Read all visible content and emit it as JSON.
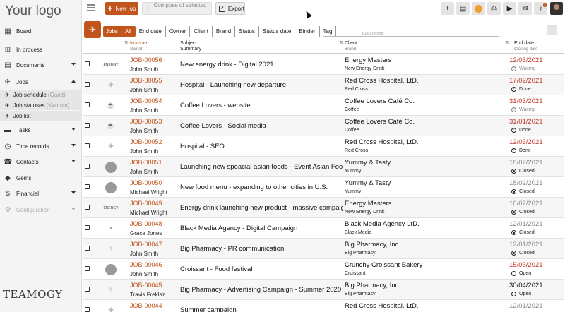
{
  "app": {
    "logo_text": "Your logo",
    "brand_logo_text": "TEAMOGY"
  },
  "toolbar": {
    "new_job_label": "New job",
    "compose_label": "Compose of selected ...",
    "export_label": "Export",
    "notification_count": "1",
    "icons": [
      "plus-icon",
      "notes-icon",
      "help-icon",
      "print-icon",
      "video-icon",
      "chat-icon",
      "bell-icon",
      "avatar"
    ]
  },
  "sidebar": {
    "items": [
      {
        "label": "Board",
        "icon": "grid-icon"
      },
      {
        "label": "In process",
        "icon": "process-icon"
      },
      {
        "label": "Documents",
        "icon": "document-icon"
      },
      {
        "label": "Jobs",
        "icon": "rocket-icon"
      },
      {
        "label": "Tasks",
        "icon": "tasks-icon"
      },
      {
        "label": "Time records",
        "icon": "clock-icon"
      },
      {
        "label": "Contacts",
        "icon": "contacts-icon"
      },
      {
        "label": "Gems",
        "icon": "gem-icon"
      },
      {
        "label": "Financial",
        "icon": "dollar-icon"
      },
      {
        "label": "Configuration",
        "icon": "gear-icon"
      }
    ],
    "jobs_sub": [
      {
        "label": "Job schedule",
        "muted": "(Gantt)"
      },
      {
        "label": "Job statuses",
        "muted": "(Kanban)"
      },
      {
        "label": "Job list",
        "muted": ""
      }
    ]
  },
  "filters": {
    "section": "Jobs",
    "active": "All",
    "crumbs": [
      "End date",
      "Owner",
      "Client",
      "Brand",
      "Status",
      "Status date",
      "Binder",
      "Tag"
    ],
    "search_count": "61/61 records"
  },
  "table": {
    "headers": {
      "number": "Number",
      "owner": "Owner",
      "subject": "Subject",
      "summary": "Summary",
      "client": "Client",
      "brand": "Brand",
      "end_date": "End date",
      "closing_date": "Closing date"
    },
    "rows": [
      {
        "thumb": "ENERGY",
        "thumb_style": "text",
        "number": "JOB-00056",
        "owner": "John Smith",
        "summary": "New energy drink - Digital 2021",
        "client": "Energy Masters",
        "brand": "New Energy Drink",
        "date": "12/03/2021",
        "date_color": "red",
        "status": "Waiting",
        "status_style": "muted"
      },
      {
        "thumb": "✚",
        "thumb_style": "faint",
        "number": "JOB-00055",
        "owner": "John Smith",
        "summary": "Hospital - Launching new departure",
        "client": "Red Cross Hospital, LtD.",
        "brand": "Red Cross",
        "date": "17/02/2021",
        "date_color": "red",
        "status": "Done",
        "status_style": "done"
      },
      {
        "thumb": "☕",
        "thumb_style": "faint",
        "number": "JOB-00054",
        "owner": "John Smith",
        "summary": "Coffee Lovers - website",
        "client": "Coffee Lovers Café Co.",
        "brand": "Coffee",
        "date": "31/03/2021",
        "date_color": "red",
        "status": "Waiting",
        "status_style": "muted"
      },
      {
        "thumb": "☕",
        "thumb_style": "faint",
        "number": "JOB-00053",
        "owner": "John Smith",
        "summary": "Coffee Lovers - Social media",
        "client": "Coffee Lovers Café Co.",
        "brand": "Coffee",
        "date": "31/01/2021",
        "date_color": "red",
        "status": "Done",
        "status_style": "done"
      },
      {
        "thumb": "✚",
        "thumb_style": "faint",
        "number": "JOB-00052",
        "owner": "John Smith",
        "summary": "Hospital - SEO",
        "client": "Red Cross Hospital, LtD.",
        "brand": "Red Cross",
        "date": "12/03/2021",
        "date_color": "red",
        "status": "Done",
        "status_style": "done"
      },
      {
        "thumb": "",
        "thumb_style": "circle",
        "number": "JOB-00051",
        "owner": "John Smith",
        "summary": "Launching new speacial asian foods - Event Asian Foo...",
        "client": "Yummy & Tasty",
        "brand": "Yummy",
        "date": "18/02/2021",
        "date_color": "gray",
        "status": "Closed",
        "status_style": "closed"
      },
      {
        "thumb": "",
        "thumb_style": "circle",
        "number": "JOB-00050",
        "owner": "Michael Wright",
        "summary": "New food menu - expanding to other cities in U.S.",
        "client": "Yummy & Tasty",
        "brand": "Yummy",
        "date": "18/02/2021",
        "date_color": "gray",
        "status": "Closed",
        "status_style": "closed"
      },
      {
        "thumb": "ENERGY",
        "thumb_style": "text",
        "number": "JOB-00049",
        "owner": "Michael Wright",
        "summary": "Energy drink launching new product - massive campaign",
        "client": "Energy Masters",
        "brand": "New Energy Drink",
        "date": "16/02/2021",
        "date_color": "gray",
        "status": "Closed",
        "status_style": "closed"
      },
      {
        "thumb": "",
        "thumb_style": "dot",
        "number": "JOB-00048",
        "owner": "Grace Jones",
        "summary": "Black Media Agency - Digital Campaign",
        "client": "Black Media Agency LtD.",
        "brand": "Black Media",
        "date": "12/01/2021",
        "date_color": "gray",
        "status": "Closed",
        "status_style": "closed"
      },
      {
        "thumb": "⚕",
        "thumb_style": "faint",
        "number": "JOB-00047",
        "owner": "John Smith",
        "summary": "Big Pharmacy - PR communication",
        "client": "Big Pharmacy, Inc.",
        "brand": "Big Pharmacy",
        "date": "12/01/2021",
        "date_color": "gray",
        "status": "Closed",
        "status_style": "closed"
      },
      {
        "thumb": "",
        "thumb_style": "circle",
        "number": "JOB-00046",
        "owner": "John Smith",
        "summary": "Croissant - Food festival",
        "client": "Crunchy Croissant Bakery",
        "brand": "Croissant",
        "date": "15/03/2021",
        "date_color": "red",
        "status": "Open",
        "status_style": "open"
      },
      {
        "thumb": "⚕",
        "thumb_style": "faint",
        "number": "JOB-00045",
        "owner": "Travis Freklaz",
        "summary": "Big Pharmacy - Advertising Campaign - Summer 2020",
        "client": "Big Pharmacy, Inc.",
        "brand": "Big Pharmacy",
        "date": "30/04/2021",
        "date_color": "black",
        "status": "Open",
        "status_style": "open"
      },
      {
        "thumb": "✚",
        "thumb_style": "faint",
        "number": "JOB-00044",
        "owner": "",
        "summary": "Summer campaign",
        "client": "Red Cross Hospital, LtD.",
        "brand": "",
        "date": "12/01/2021",
        "date_color": "gray",
        "status": "",
        "status_style": "closed"
      }
    ]
  },
  "colors": {
    "accent": "#c1551c",
    "overdue": "#c0392b",
    "muted": "#888888"
  }
}
